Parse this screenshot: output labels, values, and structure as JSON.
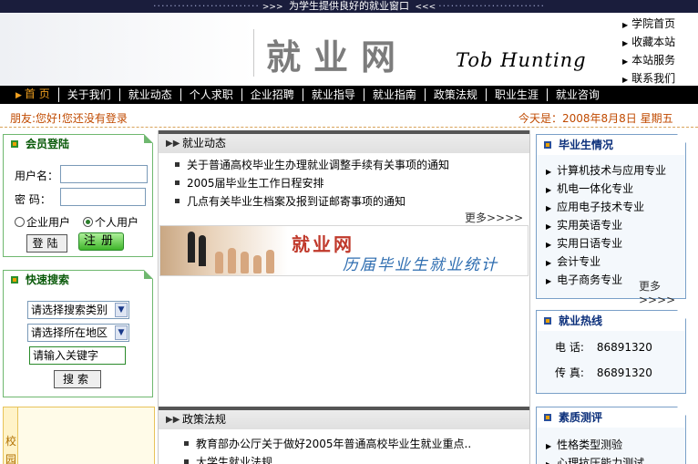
{
  "top_banner": {
    "text": "为学生提供良好的就业窗口"
  },
  "header": {
    "logo_cn": "就业网",
    "logo_en": "Tob  Hunting",
    "quick_links": [
      "学院首页",
      "收藏本站",
      "本站服务",
      "联系我们"
    ]
  },
  "nav": {
    "items": [
      "首 页",
      "关于我们",
      "就业动态",
      "个人求职",
      "企业招聘",
      "就业指导",
      "就业指南",
      "政策法规",
      "职业生涯",
      "就业咨询"
    ]
  },
  "status": {
    "greeting": "朋友:您好!您还没有登录",
    "date": "今天是：2008年8月8日  星期五"
  },
  "login": {
    "title": "会员登陆",
    "username_label": "用户名：",
    "password_label": "密  码：",
    "username_value": "",
    "password_value": "",
    "radio_company": "企业用户",
    "radio_personal": "个人用户",
    "selected_role": "个人用户",
    "login_button": "登陆",
    "register_button": "注册"
  },
  "quick_search": {
    "title": "快速搜索",
    "category_select": "请选择搜索类别",
    "region_select": "请选择所在地区",
    "keyword_value": "请输入关键字",
    "search_button": "搜索"
  },
  "campus": {
    "tab_chars": [
      "校",
      "园"
    ]
  },
  "news": {
    "title": "就业动态",
    "items": [
      "关于普通高校毕业生办理就业调整手续有关事项的通知",
      "2005届毕业生工作日程安排",
      "几点有关毕业生档案及报到证邮寄事项的通知"
    ],
    "more": "更多>>>>"
  },
  "banner": {
    "title_cn": "就业网",
    "subtitle": "历届毕业生就业统计"
  },
  "policy": {
    "title": "政策法规",
    "items": [
      "教育部办公厅关于做好2005年普通高校毕业生就业重点..",
      "大学生就业法规"
    ]
  },
  "graduates": {
    "title": "毕业生情况",
    "items": [
      "计算机技术与应用专业",
      "机电一体化专业",
      "应用电子技术专业",
      "实用英语专业",
      "实用日语专业",
      "会计专业",
      "电子商务专业"
    ],
    "more": "更多>>>>"
  },
  "hotline": {
    "title": "就业热线",
    "phone_label": "电    话:",
    "phone_value": "86891320",
    "fax_label": "传    真:",
    "fax_value": "86891320"
  },
  "quality": {
    "title": "素质测评",
    "items": [
      "性格类型测验",
      "心理抗压能力测试"
    ]
  }
}
